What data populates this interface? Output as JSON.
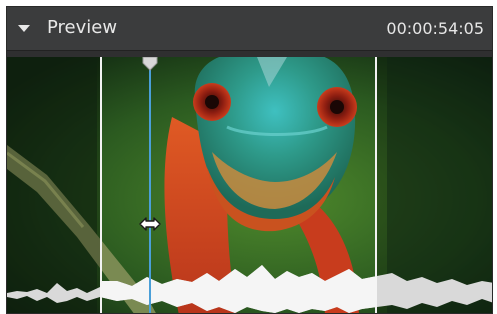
{
  "panel": {
    "title": "Preview",
    "timecode": "00:00:54:05",
    "toggle_icon": "triangle-down-icon",
    "drag_icon": "horizontal-resize-icon",
    "accent_color": "#4a9fd8"
  }
}
